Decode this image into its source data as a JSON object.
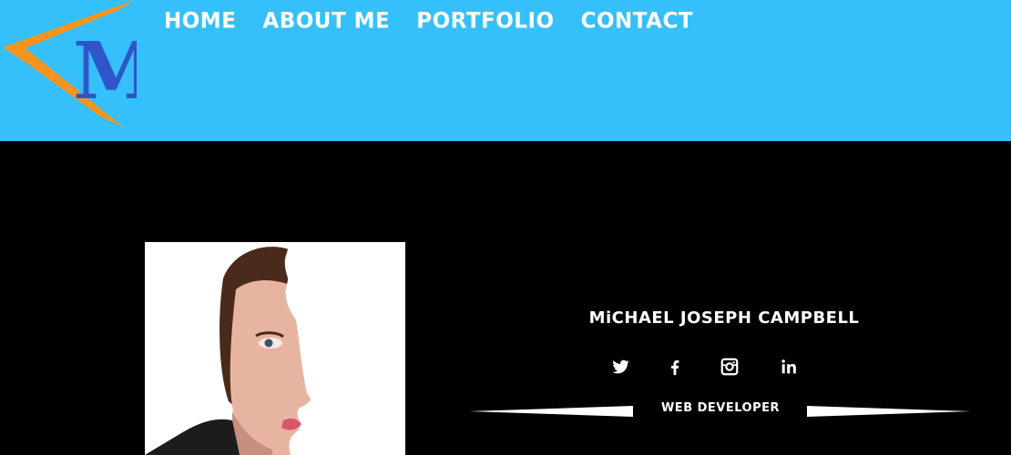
{
  "brand": {
    "logo_letter": "M",
    "colors": {
      "blue": "#2f56c8",
      "orange": "#f7941d",
      "header": "#35c0fc"
    }
  },
  "nav": {
    "items": [
      {
        "label": "HOME"
      },
      {
        "label": "ABOUT ME"
      },
      {
        "label": "PORTFOLIO"
      },
      {
        "label": "CONTACT"
      }
    ]
  },
  "profile": {
    "name": "MiCHAEL JOSEPH CAMPBELL",
    "role": "WEB DEVELOPER",
    "photo_alt": "Michael Joseph Campbell portrait"
  },
  "social": {
    "icons": [
      "twitter-icon",
      "facebook-icon",
      "instagram-icon",
      "linkedin-icon"
    ]
  }
}
